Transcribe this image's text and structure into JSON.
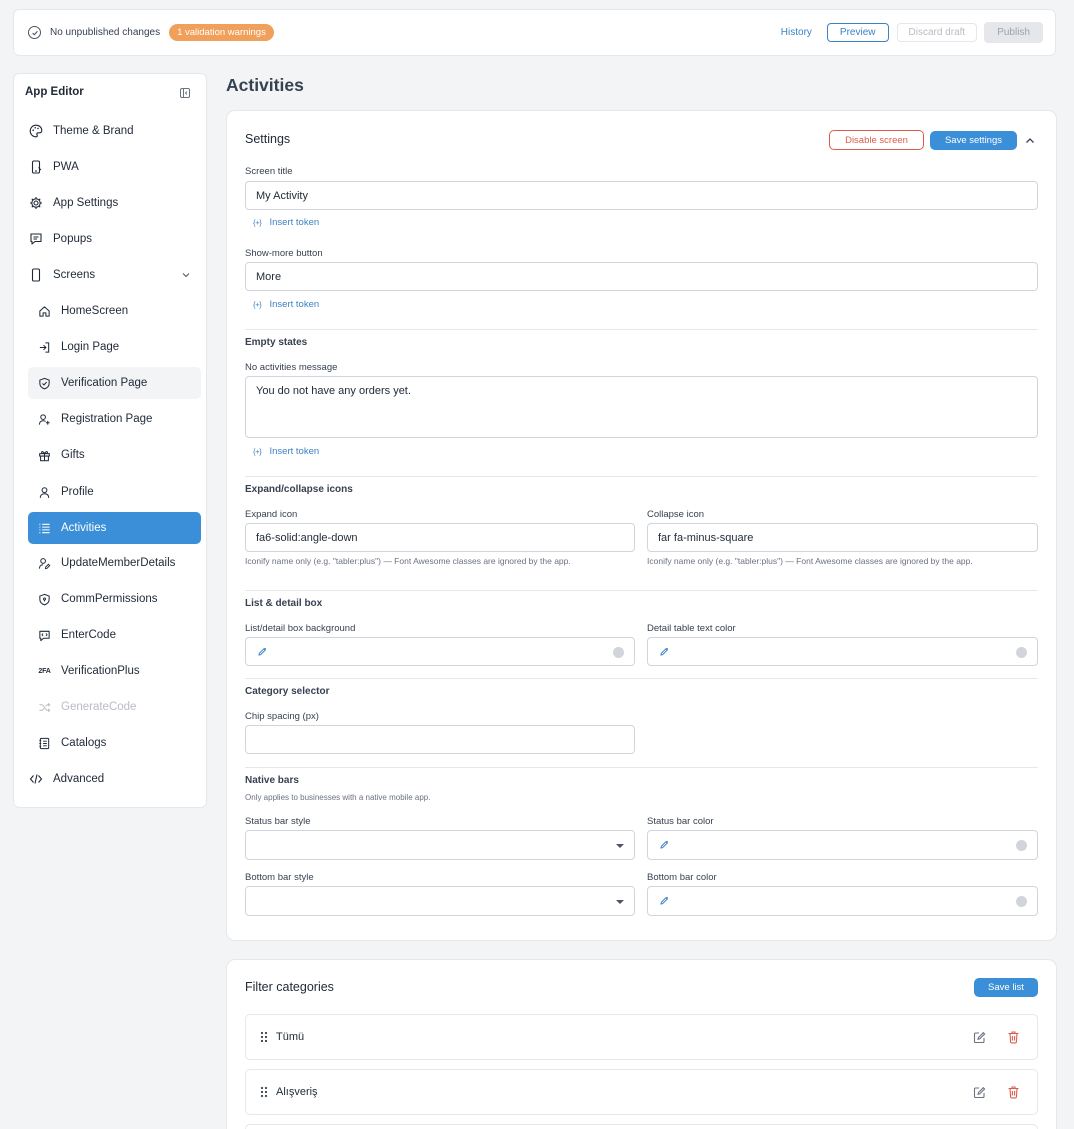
{
  "topbar": {
    "status": "No unpublished changes",
    "warnings": "1 validation warnings",
    "history": "History",
    "preview": "Preview",
    "discard": "Discard draft",
    "publish": "Publish"
  },
  "sidebar": {
    "title": "App Editor",
    "items": [
      {
        "label": "Theme & Brand",
        "icon": "palette-icon"
      },
      {
        "label": "PWA",
        "icon": "phone-icon"
      },
      {
        "label": "App Settings",
        "icon": "settings-icon"
      },
      {
        "label": "Popups",
        "icon": "message-icon"
      },
      {
        "label": "Screens",
        "icon": "device-icon"
      }
    ],
    "screens": [
      {
        "label": "HomeScreen",
        "icon": "home-icon"
      },
      {
        "label": "Login Page",
        "icon": "login-icon"
      },
      {
        "label": "Verification Page",
        "icon": "shield-check-icon"
      },
      {
        "label": "Registration Page",
        "icon": "user-plus-icon"
      },
      {
        "label": "Gifts",
        "icon": "gift-icon"
      },
      {
        "label": "Profile",
        "icon": "user-icon"
      },
      {
        "label": "Activities",
        "icon": "list-icon"
      },
      {
        "label": "UpdateMemberDetails",
        "icon": "user-edit-icon"
      },
      {
        "label": "CommPermissions",
        "icon": "shield-lock-icon"
      },
      {
        "label": "EnterCode",
        "icon": "code-message-icon"
      },
      {
        "label": "VerificationPlus",
        "icon": "2fa-icon",
        "icon_text": "2FA"
      },
      {
        "label": "GenerateCode",
        "icon": "shuffle-icon"
      },
      {
        "label": "Catalogs",
        "icon": "catalog-icon"
      }
    ],
    "advanced": {
      "label": "Advanced",
      "icon": "code-icon"
    }
  },
  "page": {
    "title": "Activities"
  },
  "settings": {
    "title": "Settings",
    "disable_screen": "Disable screen",
    "save_settings": "Save settings",
    "screen_title_label": "Screen title",
    "screen_title_value": "My Activity",
    "insert_token": "Insert token",
    "token_glyph": "{+}",
    "show_more_label": "Show-more button",
    "show_more_value": "More",
    "empty_states_heading": "Empty states",
    "no_activities_label": "No activities message",
    "no_activities_value": "You do not have any orders yet.",
    "expand_collapse_heading": "Expand/collapse icons",
    "expand_icon_label": "Expand icon",
    "expand_icon_value": "fa6-solid:angle-down",
    "collapse_icon_label": "Collapse icon",
    "collapse_icon_value": "far fa-minus-square",
    "iconify_hint": "Iconify name only (e.g. \"tabler:plus\") — Font Awesome classes are ignored by the app.",
    "list_detail_heading": "List & detail box",
    "box_bg_label": "List/detail box background",
    "detail_text_color_label": "Detail table text color",
    "category_selector_heading": "Category selector",
    "chip_spacing_label": "Chip spacing (px)",
    "native_bars_heading": "Native bars",
    "native_bars_hint": "Only applies to businesses with a native mobile app.",
    "status_bar_style_label": "Status bar style",
    "status_bar_color_label": "Status bar color",
    "bottom_bar_style_label": "Bottom bar style",
    "bottom_bar_color_label": "Bottom bar color"
  },
  "filter": {
    "title": "Filter categories",
    "save_list": "Save list",
    "items": [
      "Tümü",
      "Alışveriş"
    ]
  },
  "colors": {
    "accent": "#3b8fd8",
    "warning": "#f0a05a",
    "danger": "#dc5c4c"
  }
}
